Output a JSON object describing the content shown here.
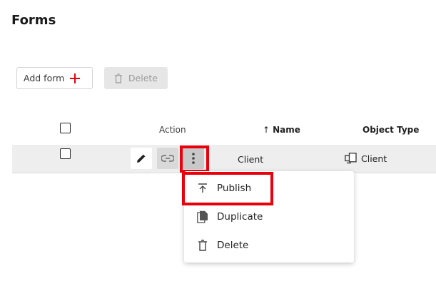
{
  "page": {
    "title": "Forms"
  },
  "toolbar": {
    "add_label": "Add form",
    "delete_label": "Delete"
  },
  "table": {
    "columns": {
      "action": "Action",
      "name": "Name",
      "name_sort_glyph": "↑",
      "object_type": "Object Type"
    },
    "rows": [
      {
        "name": "Client",
        "object_type": "Client"
      }
    ]
  },
  "row_menu": {
    "items": [
      {
        "label": "Publish",
        "icon": "publish-icon"
      },
      {
        "label": "Duplicate",
        "icon": "duplicate-icon"
      },
      {
        "label": "Delete",
        "icon": "trash-icon"
      }
    ]
  },
  "colors": {
    "accent_red": "#e8000b",
    "row_bg": "#eeeeee",
    "disabled_bg": "#e6e6e6"
  }
}
